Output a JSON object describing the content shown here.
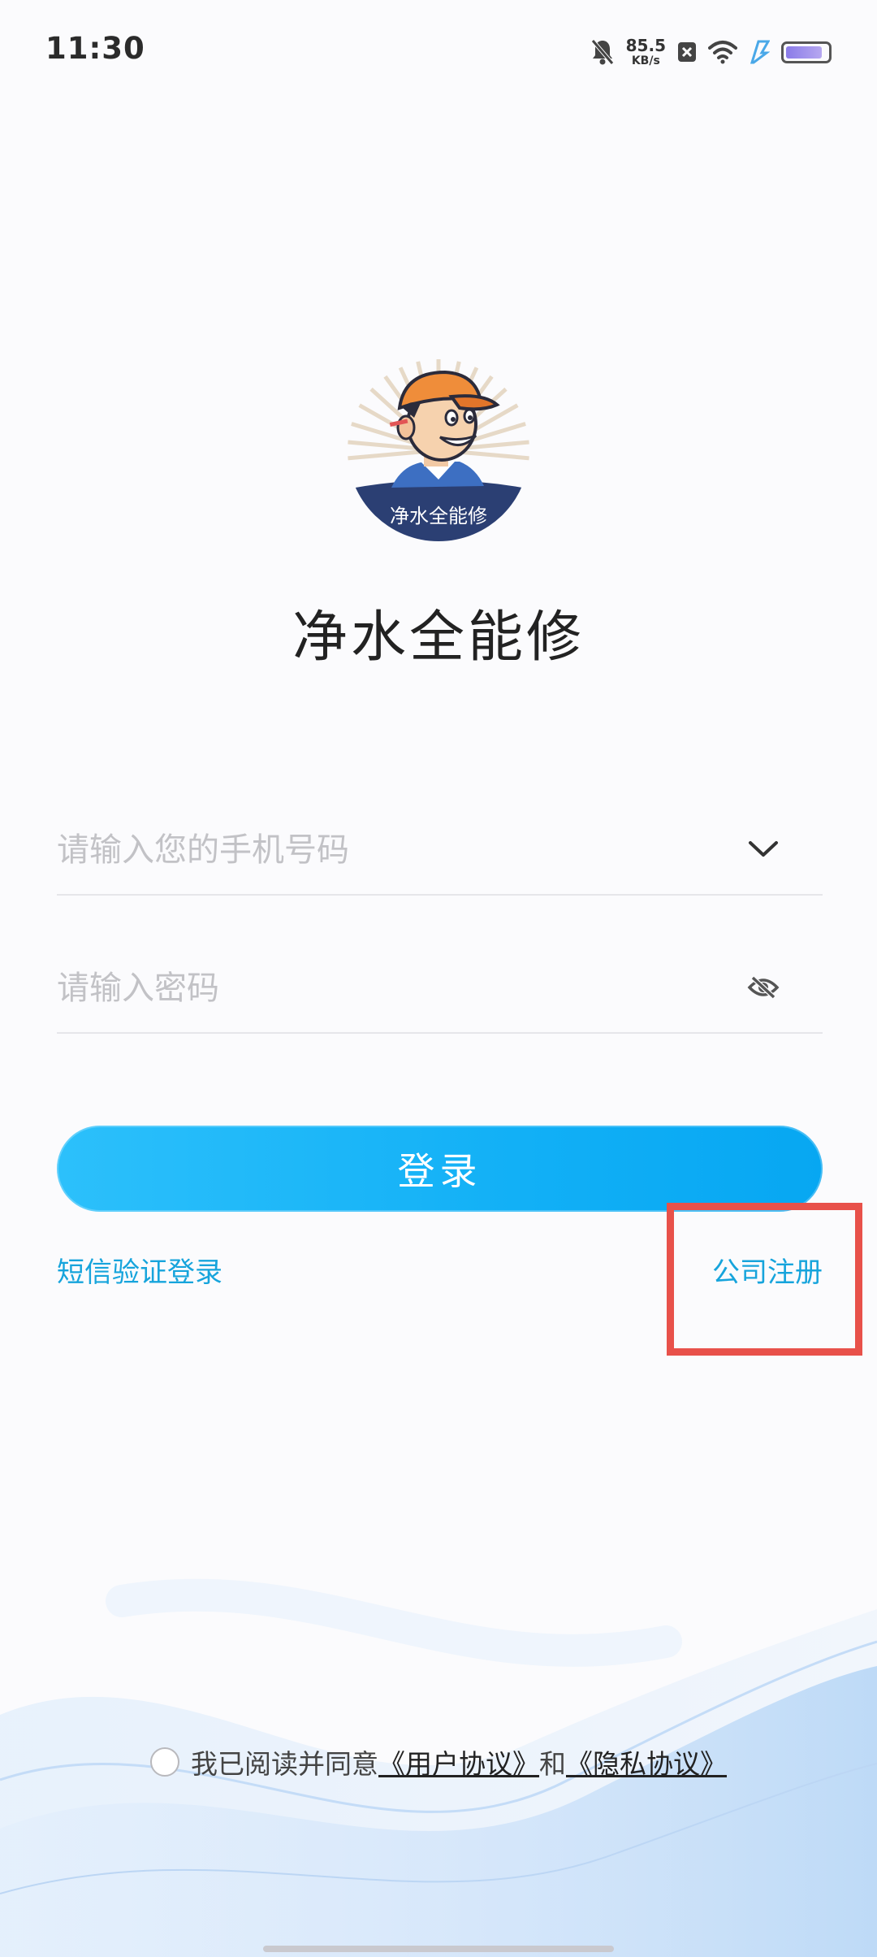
{
  "status_bar": {
    "time": "11:30",
    "net_speed_value": "85.5",
    "net_speed_unit": "KB/s",
    "icons": [
      "bell-muted-icon",
      "close-box-icon",
      "wifi-icon",
      "charging-icon",
      "battery-icon"
    ],
    "battery_level": 0.9
  },
  "app": {
    "logo_text": "净水全能修",
    "title": "净水全能修"
  },
  "login_form": {
    "phone_placeholder": "请输入您的手机号码",
    "phone_value": "",
    "password_placeholder": "请输入密码",
    "password_value": "",
    "login_button": "登录",
    "sms_login_link": "短信验证登录",
    "company_register_link": "公司注册"
  },
  "agreement": {
    "prefix": "我已阅读并同意",
    "user_agreement": "《用户协议》",
    "conjunction": "和",
    "privacy_agreement": "《隐私协议》",
    "checked": false
  },
  "colors": {
    "accent": "#16a4dc",
    "button_start": "#2cc0fb",
    "button_end": "#07a7f2",
    "highlight": "#e8514a"
  }
}
